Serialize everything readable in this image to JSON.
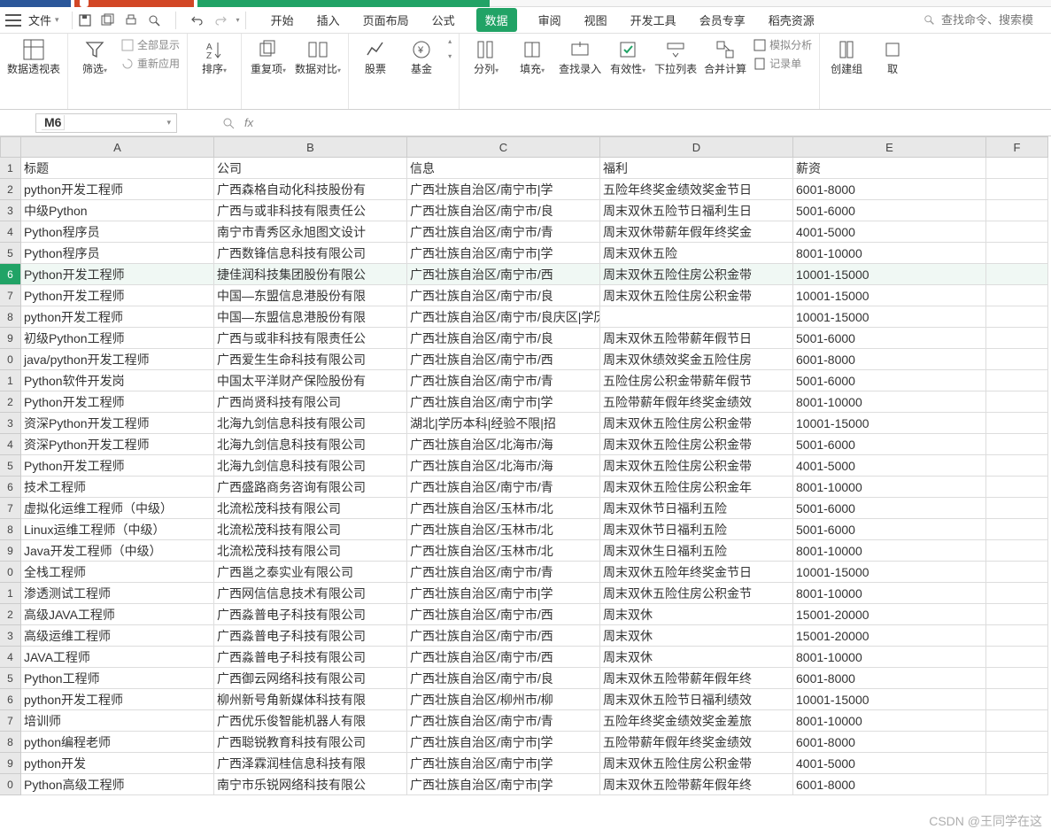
{
  "file_menu": "文件",
  "tabs": [
    "开始",
    "插入",
    "页面布局",
    "公式",
    "数据",
    "审阅",
    "视图",
    "开发工具",
    "会员专享",
    "稻壳资源"
  ],
  "active_tab_index": 4,
  "search_placeholder": "查找命令、搜索模",
  "ribbon": {
    "pivot": "数据透视表",
    "filter": "筛选",
    "show_all": "全部显示",
    "reapply": "重新应用",
    "sort": "排序",
    "dup": "重复项",
    "dataval": "数据对比",
    "stock": "股票",
    "fund": "基金",
    "split": "分列",
    "fill": "填充",
    "lookup": "查找录入",
    "validity": "有效性",
    "dropdown": "下拉列表",
    "consolidate": "合并计算",
    "simulate": "模拟分析",
    "record": "记录单",
    "group": "创建组",
    "ungroup": "取"
  },
  "namebox": "M6",
  "fx": "fx",
  "col_widths": {
    "A": 218,
    "B": 218,
    "C": 218,
    "D": 218,
    "E": 218,
    "F": 70
  },
  "columns": [
    "A",
    "B",
    "C",
    "D",
    "E",
    "F"
  ],
  "row_numbers": [
    1,
    2,
    3,
    4,
    5,
    6,
    7,
    8,
    9,
    0,
    1,
    2,
    3,
    4,
    5,
    6,
    7,
    8,
    9,
    0,
    1,
    2,
    3,
    4,
    5,
    6,
    7,
    8,
    9,
    0
  ],
  "selected_row_index": 5,
  "headers": [
    "标题",
    "公司",
    "信息",
    "福利",
    "薪资",
    ""
  ],
  "rows": [
    [
      "python开发工程师",
      "广西森格自动化科技股份有",
      "广西壮族自治区/南宁市|学",
      "五险年终奖金绩效奖金节日",
      "6001-8000",
      ""
    ],
    [
      "中级Python",
      "广西与或非科技有限责任公",
      "广西壮族自治区/南宁市/良",
      "周末双休五险节日福利生日",
      "5001-6000",
      ""
    ],
    [
      "Python程序员",
      "南宁市青秀区永旭图文设计",
      "广西壮族自治区/南宁市/青",
      "周末双休带薪年假年终奖金",
      "4001-5000",
      ""
    ],
    [
      "Python程序员",
      "广西数锋信息科技有限公司",
      "广西壮族自治区/南宁市|学",
      "周末双休五险",
      "8001-10000",
      ""
    ],
    [
      "Python开发工程师",
      "捷佳润科技集团股份有限公",
      "广西壮族自治区/南宁市/西",
      "周末双休五险住房公积金带",
      "10001-15000",
      ""
    ],
    [
      "Python开发工程师",
      "中国—东盟信息港股份有限",
      "广西壮族自治区/南宁市/良",
      "周末双休五险住房公积金带",
      "10001-15000",
      ""
    ],
    [
      "python开发工程师",
      "中国—东盟信息港股份有限",
      "广西壮族自治区/南宁市/良庆区|学历本科|经验不限|招",
      "",
      "10001-15000",
      ""
    ],
    [
      "初级Python工程师",
      "广西与或非科技有限责任公",
      "广西壮族自治区/南宁市/良",
      "周末双休五险带薪年假节日",
      "5001-6000",
      ""
    ],
    [
      "java/python开发工程师",
      "广西爱生生命科技有限公司",
      "广西壮族自治区/南宁市/西",
      "周末双休绩效奖金五险住房",
      "6001-8000",
      ""
    ],
    [
      "Python软件开发岗",
      "中国太平洋财产保险股份有",
      "广西壮族自治区/南宁市/青",
      "五险住房公积金带薪年假节",
      "5001-6000",
      ""
    ],
    [
      "Python开发工程师",
      "广西尚贤科技有限公司",
      "广西壮族自治区/南宁市|学",
      "五险带薪年假年终奖金绩效",
      "8001-10000",
      ""
    ],
    [
      "资深Python开发工程师",
      "北海九剑信息科技有限公司",
      "湖北|学历本科|经验不限|招",
      "周末双休五险住房公积金带",
      "10001-15000",
      ""
    ],
    [
      "资深Python开发工程师",
      "北海九剑信息科技有限公司",
      "广西壮族自治区/北海市/海",
      "周末双休五险住房公积金带",
      "5001-6000",
      ""
    ],
    [
      "Python开发工程师",
      "北海九剑信息科技有限公司",
      "广西壮族自治区/北海市/海",
      "周末双休五险住房公积金带",
      "4001-5000",
      ""
    ],
    [
      "技术工程师",
      "广西盛路商务咨询有限公司",
      "广西壮族自治区/南宁市/青",
      "周末双休五险住房公积金年",
      "8001-10000",
      ""
    ],
    [
      "虚拟化运维工程师（中级）",
      "北流松茂科技有限公司",
      "广西壮族自治区/玉林市/北",
      "周末双休节日福利五险",
      "5001-6000",
      ""
    ],
    [
      "Linux运维工程师（中级）",
      "北流松茂科技有限公司",
      "广西壮族自治区/玉林市/北",
      "周末双休节日福利五险",
      "5001-6000",
      ""
    ],
    [
      "Java开发工程师（中级）",
      "北流松茂科技有限公司",
      "广西壮族自治区/玉林市/北",
      "周末双休生日福利五险",
      "8001-10000",
      ""
    ],
    [
      "全栈工程师",
      "广西邕之泰实业有限公司",
      "广西壮族自治区/南宁市/青",
      "周末双休五险年终奖金节日",
      "10001-15000",
      ""
    ],
    [
      "渗透测试工程师",
      "广西网信信息技术有限公司",
      "广西壮族自治区/南宁市|学",
      "周末双休五险住房公积金节",
      "8001-10000",
      ""
    ],
    [
      "高级JAVA工程师",
      "广西淼普电子科技有限公司",
      "广西壮族自治区/南宁市/西",
      "周末双休",
      "15001-20000",
      ""
    ],
    [
      "高级运维工程师",
      "广西淼普电子科技有限公司",
      "广西壮族自治区/南宁市/西",
      "周末双休",
      "15001-20000",
      ""
    ],
    [
      "JAVA工程师",
      "广西淼普电子科技有限公司",
      "广西壮族自治区/南宁市/西",
      "周末双休",
      "8001-10000",
      ""
    ],
    [
      "Python工程师",
      "广西御云网络科技有限公司",
      "广西壮族自治区/南宁市/良",
      "周末双休五险带薪年假年终",
      "6001-8000",
      ""
    ],
    [
      "python开发工程师",
      "柳州新号角新媒体科技有限",
      "广西壮族自治区/柳州市/柳",
      "周末双休五险节日福利绩效",
      "10001-15000",
      ""
    ],
    [
      "培训师",
      "广西优乐俊智能机器人有限",
      "广西壮族自治区/南宁市/青",
      "五险年终奖金绩效奖金差旅",
      "8001-10000",
      ""
    ],
    [
      "python编程老师",
      "广西聪锐教育科技有限公司",
      "广西壮族自治区/南宁市|学",
      "五险带薪年假年终奖金绩效",
      "6001-8000",
      ""
    ],
    [
      "python开发",
      "广西泽霖润桂信息科技有限",
      "广西壮族自治区/南宁市|学",
      "周末双休五险住房公积金带",
      "4001-5000",
      ""
    ],
    [
      "Python高级工程师",
      "南宁市乐锐网络科技有限公",
      "广西壮族自治区/南宁市|学",
      "周末双休五险带薪年假年终",
      "6001-8000",
      ""
    ]
  ],
  "watermark": "CSDN @王同学在这"
}
